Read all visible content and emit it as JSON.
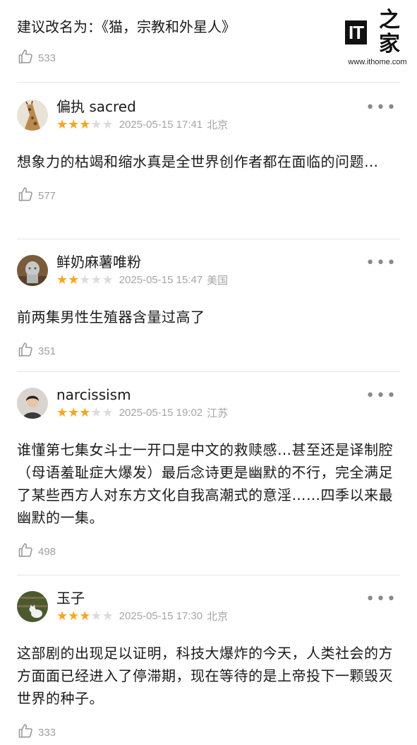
{
  "watermark": {
    "mark": "IT",
    "mark_zh": "之家",
    "url": "www.ithome.com"
  },
  "top_comment": {
    "text": "建议改名为：《猫，宗教和外星人》",
    "likes": "533"
  },
  "reviews": [
    {
      "username": "偏执 sacred",
      "rating": 3,
      "datetime": "2025-05-15 17:41",
      "location": "北京",
      "text": "想象力的枯竭和缩水真是全世界创作者都在面临的问题…",
      "likes": "577",
      "avatar_icon": "giraffe-avatar"
    },
    {
      "username": "鲜奶麻薯唯粉",
      "rating": 2,
      "datetime": "2025-05-15 15:47",
      "location": "美国",
      "text": "前两集男性生殖器含量过高了",
      "likes": "351",
      "avatar_icon": "statue-avatar"
    },
    {
      "username": "narcissism",
      "rating": 3,
      "datetime": "2025-05-15 19:02",
      "location": "江苏",
      "text": "谁懂第七集女斗士一开口是中文的救赎感…甚至还是译制腔（母语羞耻症大爆发）最后念诗更是幽默的不行，完全满足了某些西方人对东方文化自我高潮式的意淫……四季以来最幽默的一集。",
      "likes": "498",
      "avatar_icon": "portrait-avatar"
    },
    {
      "username": "玉子",
      "rating": 3,
      "datetime": "2025-05-15 17:30",
      "location": "北京",
      "text": "这部剧的出现足以证明，科技大爆炸的今天，人类社会的方方面面已经进入了停滞期，现在等待的是上帝投下一颗毁灭世界的种子。",
      "likes": "333",
      "avatar_icon": "cat-avatar"
    }
  ],
  "colors": {
    "star_on": "#f5a623",
    "star_off": "#dcdcdc",
    "meta_gray": "#a6a6a6",
    "divider": "#e6e6e6"
  }
}
